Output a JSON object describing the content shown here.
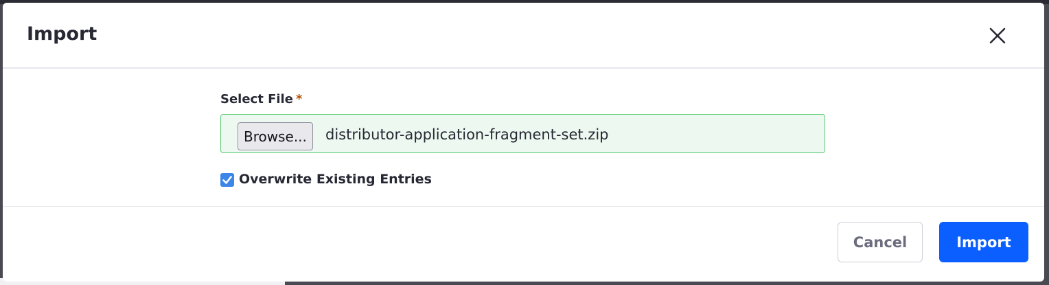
{
  "dialog": {
    "title": "Import",
    "close_icon": "close-icon",
    "select_file_label": "Select File",
    "required_marker": "*",
    "browse_label": "Browse...",
    "file_name": "distributor-application-fragment-set.zip",
    "overwrite_label": "Overwrite Existing Entries",
    "overwrite_checked": true,
    "cancel_label": "Cancel",
    "import_label": "Import",
    "colors": {
      "primary": "#0b5fff",
      "valid_border": "#5aca75",
      "required": "#b95000"
    }
  }
}
